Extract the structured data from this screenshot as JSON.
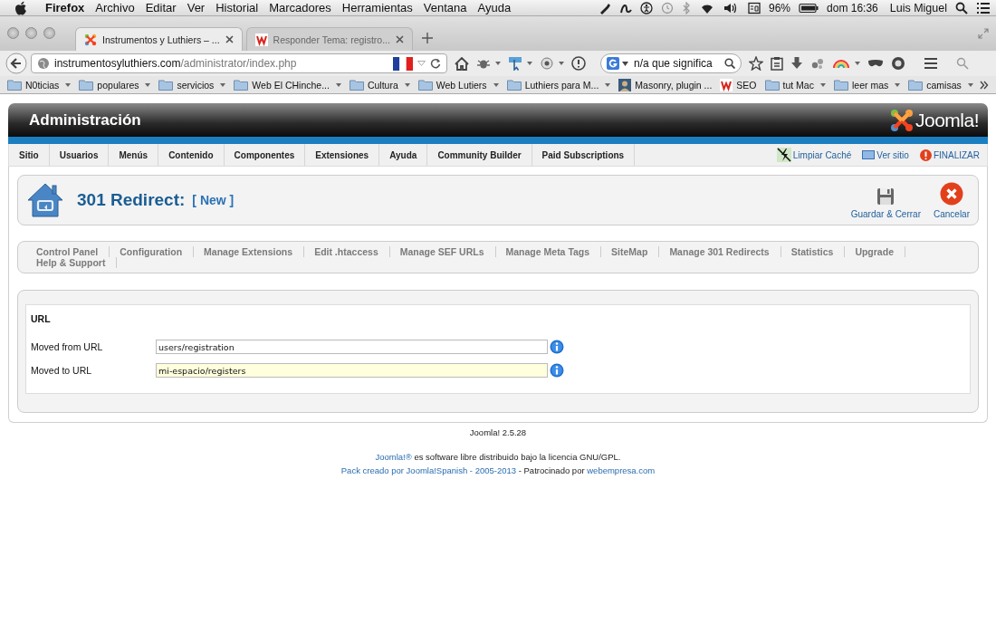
{
  "system_menu_bar": {
    "app": "Firefox",
    "menus": [
      "Archivo",
      "Editar",
      "Ver",
      "Historial",
      "Marcadores",
      "Herramientas",
      "Ventana",
      "Ayuda"
    ],
    "battery": "96%",
    "clock": "dom 16:36",
    "user": "Luis Miguel"
  },
  "browser": {
    "tabs": [
      {
        "title": "Instrumentos y Luthiers – ...",
        "kind": "joomla",
        "selected": true
      },
      {
        "title": "Responder Tema: registro...",
        "kind": "site",
        "selected": false
      }
    ],
    "address": {
      "host": "instrumentosyluthiers.com",
      "path": "/administrator/index.php"
    },
    "search": {
      "value": "n/a que significa"
    },
    "bookmarks": [
      {
        "label": "N0ticias",
        "kind": "folder",
        "menu": true
      },
      {
        "label": "populares",
        "kind": "folder",
        "menu": true
      },
      {
        "label": "servicios",
        "kind": "folder",
        "menu": true
      },
      {
        "label": "Web El CHinche...",
        "kind": "folder",
        "menu": true
      },
      {
        "label": "Cultura",
        "kind": "folder",
        "menu": true
      },
      {
        "label": "Web Lutiers",
        "kind": "folder",
        "menu": true
      },
      {
        "label": "Luthiers para M...",
        "kind": "folder",
        "menu": true
      },
      {
        "label": "Masonry, plugin ...",
        "kind": "avatar",
        "menu": false
      },
      {
        "label": "SEO",
        "kind": "site",
        "menu": false
      },
      {
        "label": "tut Mac",
        "kind": "folder",
        "menu": true
      },
      {
        "label": "leer mas",
        "kind": "folder",
        "menu": true
      },
      {
        "label": "camisas",
        "kind": "folder",
        "menu": true
      }
    ]
  },
  "admin": {
    "title": "Administración",
    "brand": "Joomla!",
    "menu": [
      {
        "label": "Sitio"
      },
      {
        "label": "Usuarios"
      },
      {
        "label": "Menús"
      },
      {
        "label": "Contenido"
      },
      {
        "label": "Componentes"
      },
      {
        "label": "Extensiones"
      },
      {
        "label": "Ayuda"
      },
      {
        "label": "Community Builder"
      },
      {
        "label": "Paid Subscriptions"
      }
    ],
    "header_links": [
      {
        "label": "Limpiar Caché",
        "kind": "cache"
      },
      {
        "label": "Ver sitio",
        "kind": "monitor"
      },
      {
        "label": "FINALIZAR",
        "kind": "logout"
      }
    ],
    "page_title": "301 Redirect:",
    "page_subtitle": "[ New ]",
    "toolbar": [
      {
        "label": "Guardar & Cerrar",
        "kind": "save"
      },
      {
        "label": "Cancelar",
        "kind": "cancel"
      }
    ],
    "submenu": [
      "Control Panel",
      "Configuration",
      "Manage Extensions",
      "Edit .htaccess",
      "Manage SEF URLs",
      "Manage Meta Tags",
      "SiteMap",
      "Manage 301 Redirects",
      "Statistics",
      "Upgrade",
      "Help & Support"
    ],
    "form": {
      "legend": "URL",
      "fields": [
        {
          "label": "Moved from URL",
          "value": "users/registration",
          "focused": false
        },
        {
          "label": "Moved to URL",
          "value": "mi-espacio/registers",
          "focused": true
        }
      ]
    }
  },
  "footer": {
    "version": "Joomla! 2.5.28",
    "lines": [
      [
        {
          "kind": "link",
          "text": "Joomla!®"
        },
        {
          "kind": "text",
          "text": " es software libre distribuido bajo la licencia GNU/GPL."
        }
      ],
      [
        {
          "kind": "link",
          "text": "Pack creado por Joomla!Spanish - 2005-2013"
        },
        {
          "kind": "text",
          "text": " - Patrocinado por "
        },
        {
          "kind": "link",
          "text": "webempresa.com"
        }
      ]
    ]
  }
}
